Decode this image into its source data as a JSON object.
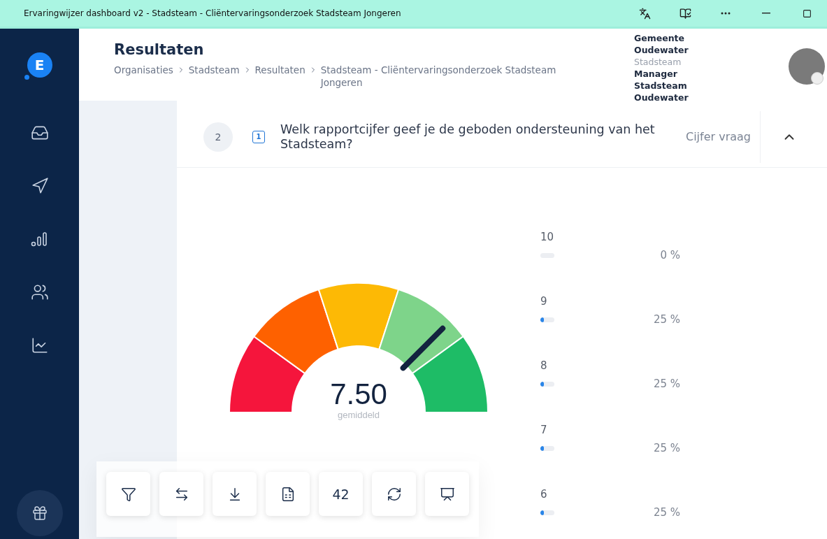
{
  "window": {
    "title": "Ervaringwijzer dashboard v2 - Stadsteam - Cliëntervaringsonderzoek Stadsteam Jongeren"
  },
  "sidebar": {
    "logo": "E",
    "items": [
      {
        "selected": false
      },
      {
        "selected": false
      },
      {
        "selected": false
      },
      {
        "selected": false
      },
      {
        "selected": false
      }
    ]
  },
  "header": {
    "title": "Resultaten",
    "breadcrumb": [
      "Organisaties",
      "Stadsteam",
      "Resultaten",
      "Stadsteam - Cliëntervaringsonderzoek Stadsteam Jongeren"
    ]
  },
  "user": {
    "lines": [
      {
        "text": "Gemeente",
        "muted": false
      },
      {
        "text": "Oudewater",
        "muted": false
      },
      {
        "text": "Stadsteam",
        "muted": true
      },
      {
        "text": "Manager",
        "muted": false
      },
      {
        "text": "Stadsteam",
        "muted": false
      },
      {
        "text": "Oudewater",
        "muted": false
      }
    ]
  },
  "question": {
    "number": "2",
    "type_badge": "1",
    "text": "Welk rapportcijfer geef je de geboden ondersteuning van het Stadsteam?",
    "type": "Cijfer vraag",
    "expanded": true
  },
  "gauge": {
    "value": "7.50",
    "caption": "gemiddeld",
    "level": 0.75
  },
  "distribution": [
    {
      "label": "10",
      "level": 0,
      "percent": "0 %"
    },
    {
      "label": "9",
      "level": 0.25,
      "percent": "25 %"
    },
    {
      "label": "8",
      "level": 0.25,
      "percent": "25 %"
    },
    {
      "label": "7",
      "level": 0.25,
      "percent": "25 %"
    },
    {
      "label": "6",
      "level": 0.25,
      "percent": "25 %"
    }
  ],
  "toolbar": [
    {
      "kind": "icon"
    },
    {
      "kind": "icon"
    },
    {
      "kind": "icon"
    },
    {
      "kind": "icon"
    },
    {
      "kind": "text",
      "text": "42"
    },
    {
      "kind": "icon"
    },
    {
      "kind": "icon"
    }
  ]
}
